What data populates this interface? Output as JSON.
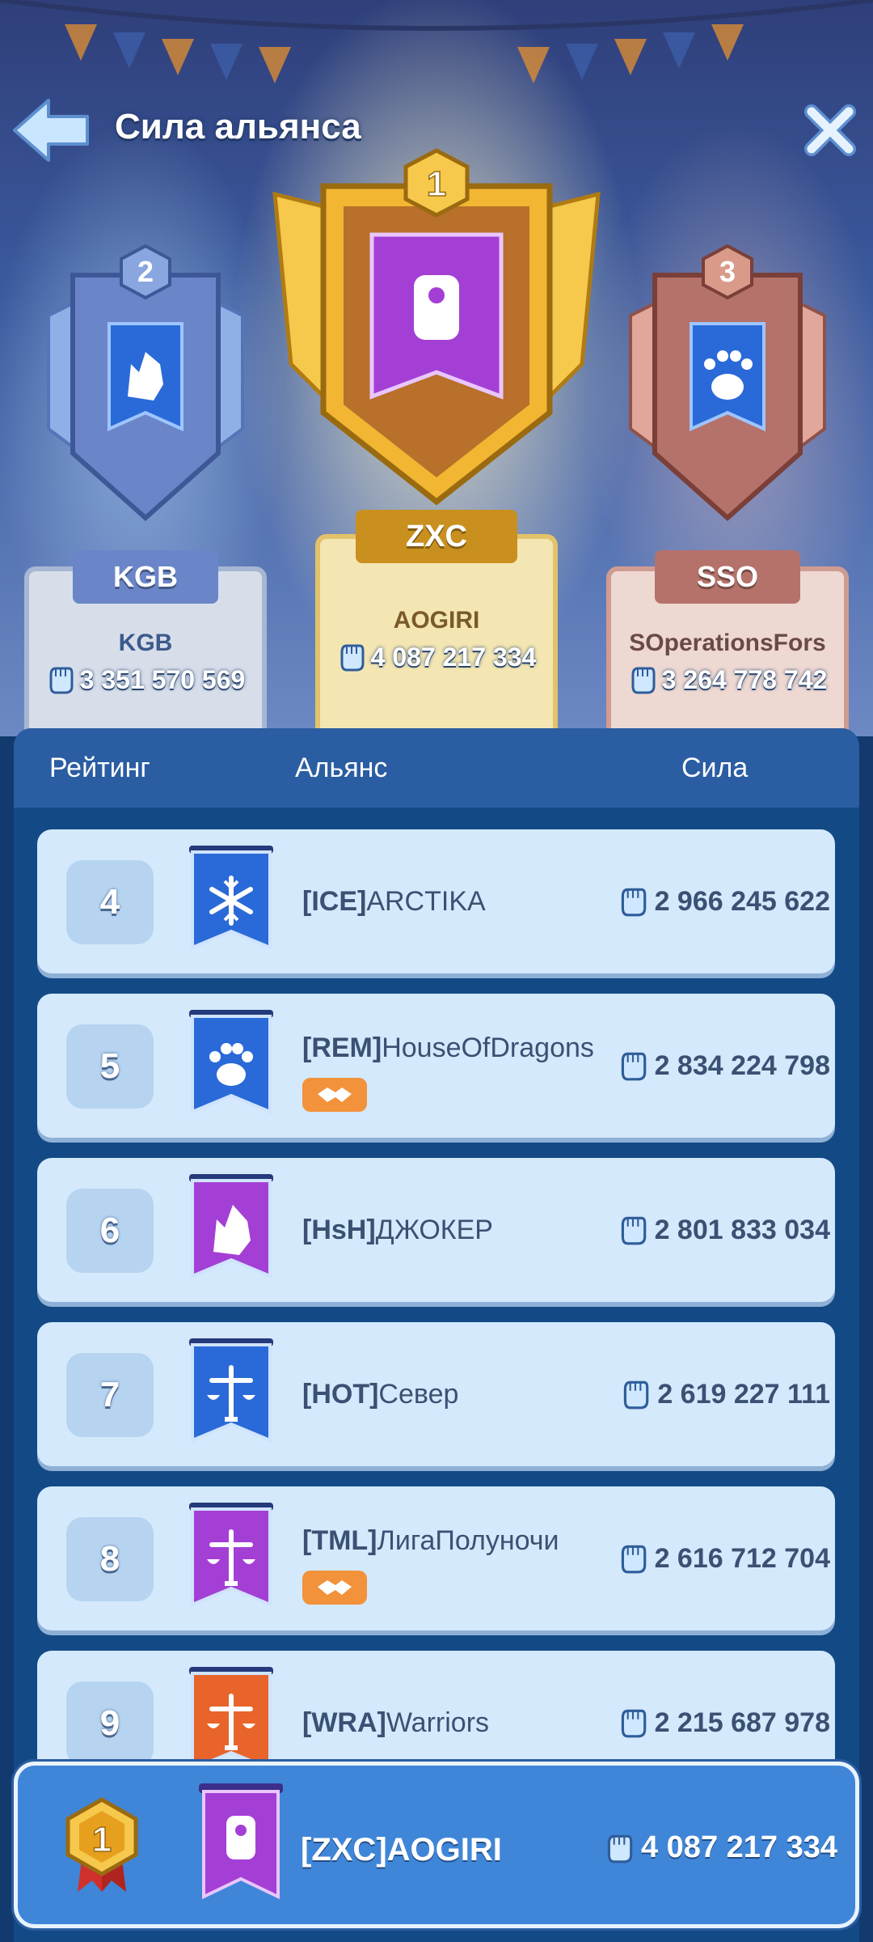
{
  "header": {
    "title": "Сила альянса"
  },
  "podium": [
    {
      "place": "1",
      "tag": "ZXC",
      "name": "AOGIRI",
      "power": "4 087 217 334",
      "emblem": "gauntlet-icon"
    },
    {
      "place": "2",
      "tag": "KGB",
      "name": "KGB",
      "power": "3 351 570 569",
      "emblem": "wolf-icon"
    },
    {
      "place": "3",
      "tag": "SSO",
      "name": "SOperationsFors",
      "power": "3 264 778 742",
      "emblem": "paw-icon"
    }
  ],
  "table": {
    "headers": {
      "rank": "Рейтинг",
      "alliance": "Альянс",
      "power": "Сила"
    },
    "rows": [
      {
        "rank": "4",
        "tag": "[ICE]",
        "name": "ARCTIKA",
        "power": "2 966 245 622",
        "emblem": "snowflake-icon",
        "flag_color": "#2a6ad8",
        "pact": false
      },
      {
        "rank": "5",
        "tag": "[REM]",
        "name": "HouseOfDragons",
        "power": "2 834 224 798",
        "emblem": "paw-icon",
        "flag_color": "#2a6ad8",
        "pact": true
      },
      {
        "rank": "6",
        "tag": "[HsH]",
        "name": "ДЖОКЕР",
        "power": "2 801 833 034",
        "emblem": "wolf-icon",
        "flag_color": "#a43fd6",
        "pact": false
      },
      {
        "rank": "7",
        "tag": "[HOT]",
        "name": "Север",
        "power": "2 619 227 111",
        "emblem": "scales-icon",
        "flag_color": "#2a6ad8",
        "pact": false
      },
      {
        "rank": "8",
        "tag": "[TML]",
        "name": "ЛигаПолуночи",
        "power": "2 616 712 704",
        "emblem": "scales-icon",
        "flag_color": "#a43fd6",
        "pact": true
      },
      {
        "rank": "9",
        "tag": "[WRA]",
        "name": "Warriors",
        "power": "2 215 687 978",
        "emblem": "scales-icon",
        "flag_color": "#e8642a",
        "pact": false
      }
    ]
  },
  "my_alliance": {
    "rank": "1",
    "tag": "[ZXC]",
    "name": "AOGIRI",
    "power": "4 087 217 334",
    "emblem": "gauntlet-icon"
  },
  "colors": {
    "gold": "#f2b632",
    "silver": "#6a86c9",
    "bronze": "#b5726a",
    "panel": "#134a86",
    "row": "#d4e9fb",
    "pact": "#f2923a"
  }
}
